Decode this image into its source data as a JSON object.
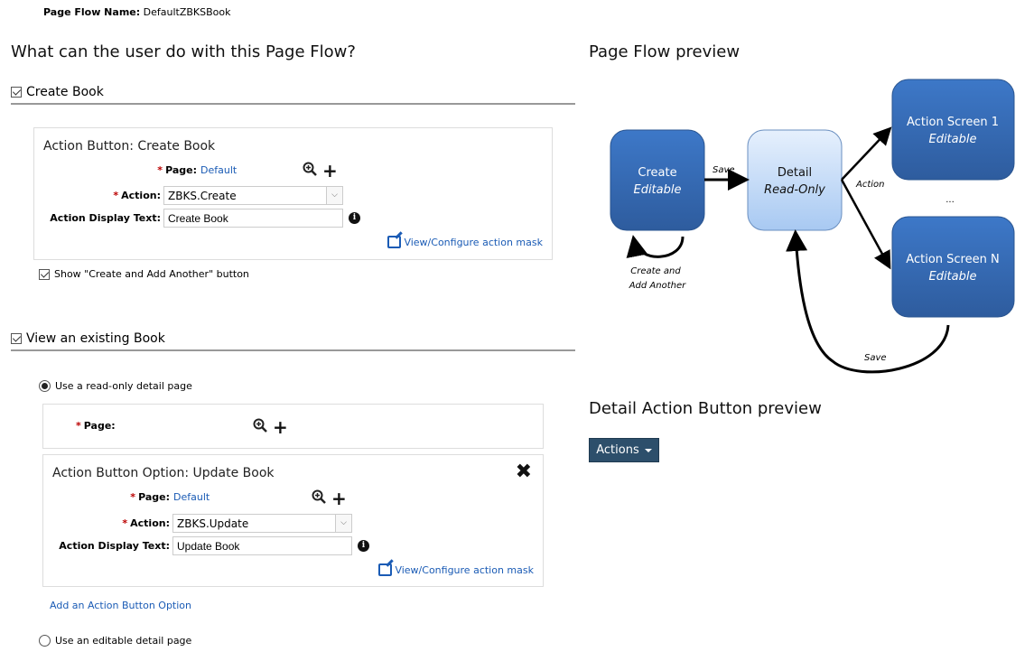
{
  "page_flow_name": {
    "label": "Page Flow Name:",
    "value": "DefaultZBKSBook"
  },
  "main_heading": "What can the user do with this Page Flow?",
  "create_section": {
    "checkbox_label": "Create Book",
    "checked": true,
    "panel": {
      "title": "Action Button: Create Book",
      "page_label": "Page:",
      "page_value": "Default",
      "action_label": "Action:",
      "action_value": "ZBKS.Create",
      "display_text_label": "Action Display Text:",
      "display_text_value": "Create Book",
      "mask_link": "View/Configure action mask"
    },
    "show_create_another": {
      "label": "Show \"Create and Add Another\" button",
      "checked": true
    }
  },
  "view_section": {
    "checkbox_label": "View an existing Book",
    "checked": true,
    "radio_readonly": {
      "label": "Use a read-only detail page",
      "selected": true
    },
    "page_panel": {
      "page_label": "Page:",
      "page_value": ""
    },
    "option_panel": {
      "title": "Action Button Option: Update Book",
      "page_label": "Page:",
      "page_value": "Default",
      "action_label": "Action:",
      "action_value": "ZBKS.Update",
      "display_text_label": "Action Display Text:",
      "display_text_value": "Update Book",
      "mask_link": "View/Configure action mask"
    },
    "add_option_link": "Add an Action Button Option",
    "radio_editable": {
      "label": "Use an editable detail page",
      "selected": false
    }
  },
  "preview": {
    "heading": "Page Flow preview",
    "nodes": {
      "create": {
        "title": "Create",
        "subtitle": "Editable"
      },
      "detail": {
        "title": "Detail",
        "subtitle": "Read-Only"
      },
      "action1": {
        "title": "Action Screen 1",
        "subtitle": "Editable"
      },
      "actionN": {
        "title": "Action Screen N",
        "subtitle": "Editable"
      }
    },
    "edges": {
      "save1": "Save",
      "action": "Action",
      "ellipsis": "...",
      "create_another_1": "Create and",
      "create_another_2": "Add Another",
      "save2": "Save"
    },
    "colors": {
      "dark_node": "#3a6eb5",
      "light_node": "#c5dcf8"
    }
  },
  "button_preview": {
    "heading": "Detail Action Button preview",
    "button_label": "Actions"
  }
}
